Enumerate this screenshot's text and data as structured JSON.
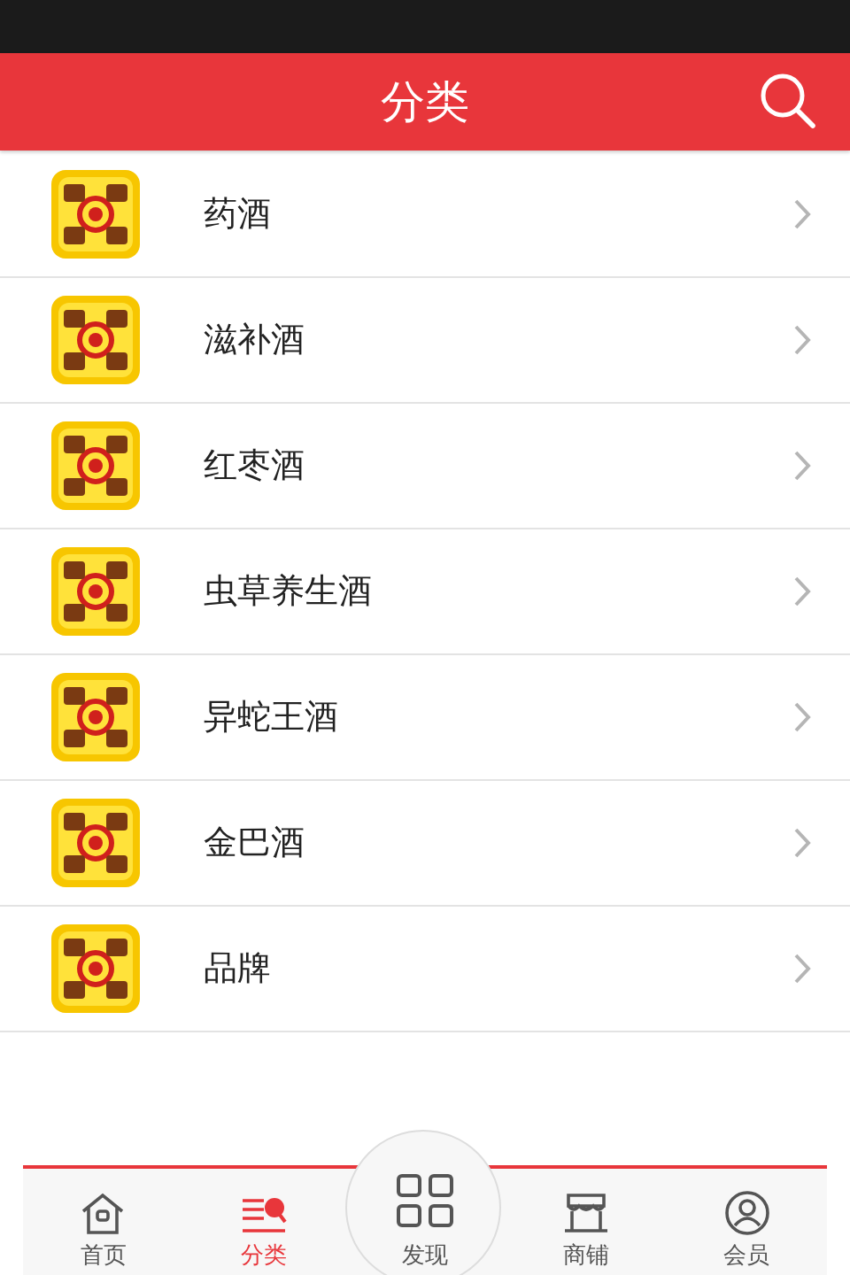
{
  "header": {
    "title": "分类"
  },
  "categories": [
    {
      "name": "药酒",
      "kind": "picture"
    },
    {
      "name": "滋补酒",
      "kind": "picture"
    },
    {
      "name": "红枣酒",
      "kind": "picture"
    },
    {
      "name": "虫草养生酒",
      "kind": "picture"
    },
    {
      "name": "异蛇王酒",
      "kind": "picture"
    },
    {
      "name": "金巴酒",
      "kind": "picture"
    },
    {
      "name": "品牌",
      "kind": "picture"
    }
  ],
  "tab_bar": [
    {
      "label": "首页",
      "kind": "home",
      "selected": false
    },
    {
      "label": "分类",
      "kind": "category",
      "selected": true
    },
    {
      "label": "发现",
      "kind": "grid",
      "selected": false
    },
    {
      "label": "商铺",
      "kind": "shop",
      "selected": false
    },
    {
      "label": "会员",
      "kind": "user",
      "selected": false
    }
  ]
}
